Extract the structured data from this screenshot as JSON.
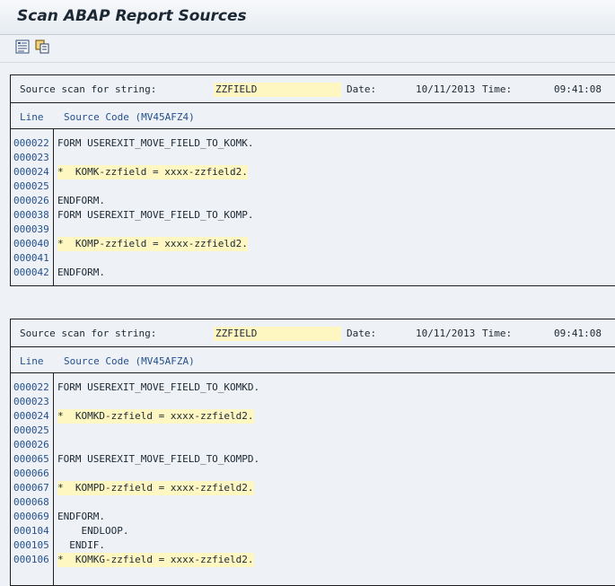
{
  "window": {
    "title": "Scan ABAP Report Sources"
  },
  "toolbar": {
    "icons": [
      "list-detail-icon",
      "copy-icon"
    ]
  },
  "blocks": [
    {
      "label": "Source scan for string:",
      "string": "ZZFIELD",
      "date_label": "Date:",
      "date": "10/11/2013",
      "time_label": "Time:",
      "time": "09:41:08",
      "col_line": "Line",
      "col_source": "Source Code (MV45AFZ4)",
      "lines": [
        {
          "ln": "000022",
          "src": "FORM USEREXIT_MOVE_FIELD_TO_KOMK.",
          "hl": false
        },
        {
          "ln": "000023",
          "src": "",
          "hl": false
        },
        {
          "ln": "000024",
          "src": "*  KOMK-zzfield = xxxx-zzfield2.",
          "hl": true
        },
        {
          "ln": "000025",
          "src": "",
          "hl": false
        },
        {
          "ln": "000026",
          "src": "ENDFORM.",
          "hl": false
        },
        {
          "ln": "000038",
          "src": "FORM USEREXIT_MOVE_FIELD_TO_KOMP.",
          "hl": false
        },
        {
          "ln": "000039",
          "src": "",
          "hl": false
        },
        {
          "ln": "000040",
          "src": "*  KOMP-zzfield = xxxx-zzfield2.",
          "hl": true
        },
        {
          "ln": "000041",
          "src": "",
          "hl": false
        },
        {
          "ln": "000042",
          "src": "ENDFORM.",
          "hl": false
        }
      ]
    },
    {
      "label": "Source scan for string:",
      "string": "ZZFIELD",
      "date_label": "Date:",
      "date": "10/11/2013",
      "time_label": "Time:",
      "time": "09:41:08",
      "col_line": "Line",
      "col_source": "Source Code (MV45AFZA)",
      "lines": [
        {
          "ln": "000022",
          "src": "FORM USEREXIT_MOVE_FIELD_TO_KOMKD.",
          "hl": false
        },
        {
          "ln": "000023",
          "src": "",
          "hl": false
        },
        {
          "ln": "000024",
          "src": "*  KOMKD-zzfield = xxxx-zzfield2.",
          "hl": true
        },
        {
          "ln": "000025",
          "src": "",
          "hl": false
        },
        {
          "ln": "000026",
          "src": "",
          "hl": false
        },
        {
          "ln": "000065",
          "src": "FORM USEREXIT_MOVE_FIELD_TO_KOMPD.",
          "hl": false
        },
        {
          "ln": "000066",
          "src": "",
          "hl": false
        },
        {
          "ln": "000067",
          "src": "*  KOMPD-zzfield = xxxx-zzfield2.",
          "hl": true
        },
        {
          "ln": "000068",
          "src": "",
          "hl": false
        },
        {
          "ln": "000069",
          "src": "ENDFORM.",
          "hl": false
        },
        {
          "ln": "000104",
          "src": "    ENDLOOP.",
          "hl": false
        },
        {
          "ln": "000105",
          "src": "  ENDIF.",
          "hl": false
        },
        {
          "ln": "000106",
          "src": "*  KOMKG-zzfield = xxxx-zzfield2.",
          "hl": true
        }
      ]
    }
  ]
}
